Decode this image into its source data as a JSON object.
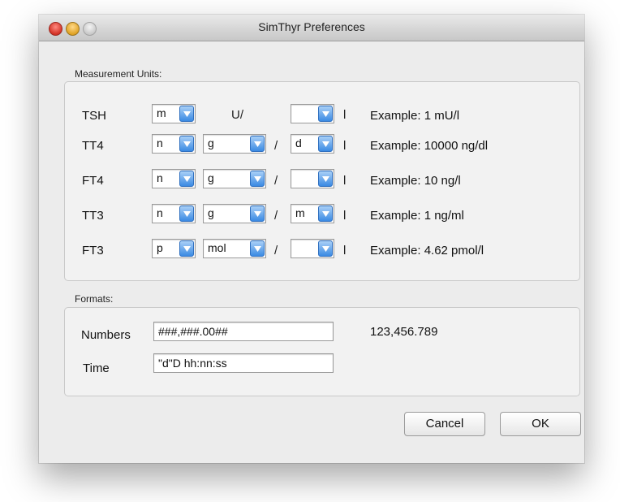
{
  "window": {
    "title": "SimThyr Preferences"
  },
  "units": {
    "group_label": "Measurement Units:",
    "separator": "/",
    "suffix": "l",
    "rows": [
      {
        "label": "TSH",
        "prefix": "m",
        "base": "U/",
        "denom": "",
        "example": "Example: 1 mU/l"
      },
      {
        "label": "TT4",
        "prefix": "n",
        "base": "g",
        "denom": "d",
        "example": "Example: 10000 ng/dl"
      },
      {
        "label": "FT4",
        "prefix": "n",
        "base": "g",
        "denom": "",
        "example": "Example: 10 ng/l"
      },
      {
        "label": "TT3",
        "prefix": "n",
        "base": "g",
        "denom": "m",
        "example": "Example: 1 ng/ml"
      },
      {
        "label": "FT3",
        "prefix": "p",
        "base": "mol",
        "denom": "",
        "example": "Example: 4.62 pmol/l"
      }
    ]
  },
  "formats": {
    "group_label": "Formats:",
    "numbers_label": "Numbers",
    "numbers_value": "###,###.00##",
    "numbers_example": "123,456.789",
    "time_label": "Time",
    "time_value": "\"d\"D hh:nn:ss"
  },
  "buttons": {
    "cancel": "Cancel",
    "ok": "OK"
  },
  "colors": {
    "accent": "#3b8ae3"
  }
}
